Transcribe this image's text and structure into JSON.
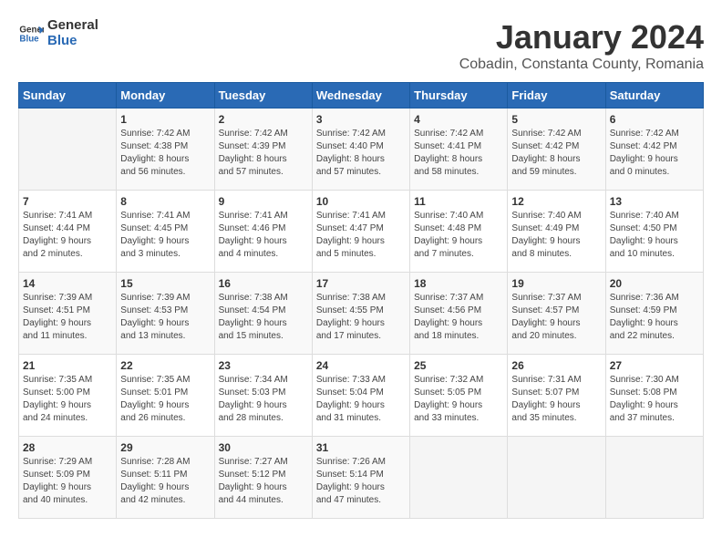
{
  "logo": {
    "line1": "General",
    "line2": "Blue"
  },
  "header": {
    "title": "January 2024",
    "subtitle": "Cobadin, Constanta County, Romania"
  },
  "days_of_week": [
    "Sunday",
    "Monday",
    "Tuesday",
    "Wednesday",
    "Thursday",
    "Friday",
    "Saturday"
  ],
  "weeks": [
    [
      {
        "day": "",
        "info": ""
      },
      {
        "day": "1",
        "info": "Sunrise: 7:42 AM\nSunset: 4:38 PM\nDaylight: 8 hours\nand 56 minutes."
      },
      {
        "day": "2",
        "info": "Sunrise: 7:42 AM\nSunset: 4:39 PM\nDaylight: 8 hours\nand 57 minutes."
      },
      {
        "day": "3",
        "info": "Sunrise: 7:42 AM\nSunset: 4:40 PM\nDaylight: 8 hours\nand 57 minutes."
      },
      {
        "day": "4",
        "info": "Sunrise: 7:42 AM\nSunset: 4:41 PM\nDaylight: 8 hours\nand 58 minutes."
      },
      {
        "day": "5",
        "info": "Sunrise: 7:42 AM\nSunset: 4:42 PM\nDaylight: 8 hours\nand 59 minutes."
      },
      {
        "day": "6",
        "info": "Sunrise: 7:42 AM\nSunset: 4:42 PM\nDaylight: 9 hours\nand 0 minutes."
      }
    ],
    [
      {
        "day": "7",
        "info": "Sunrise: 7:41 AM\nSunset: 4:44 PM\nDaylight: 9 hours\nand 2 minutes."
      },
      {
        "day": "8",
        "info": "Sunrise: 7:41 AM\nSunset: 4:45 PM\nDaylight: 9 hours\nand 3 minutes."
      },
      {
        "day": "9",
        "info": "Sunrise: 7:41 AM\nSunset: 4:46 PM\nDaylight: 9 hours\nand 4 minutes."
      },
      {
        "day": "10",
        "info": "Sunrise: 7:41 AM\nSunset: 4:47 PM\nDaylight: 9 hours\nand 5 minutes."
      },
      {
        "day": "11",
        "info": "Sunrise: 7:40 AM\nSunset: 4:48 PM\nDaylight: 9 hours\nand 7 minutes."
      },
      {
        "day": "12",
        "info": "Sunrise: 7:40 AM\nSunset: 4:49 PM\nDaylight: 9 hours\nand 8 minutes."
      },
      {
        "day": "13",
        "info": "Sunrise: 7:40 AM\nSunset: 4:50 PM\nDaylight: 9 hours\nand 10 minutes."
      }
    ],
    [
      {
        "day": "14",
        "info": "Sunrise: 7:39 AM\nSunset: 4:51 PM\nDaylight: 9 hours\nand 11 minutes."
      },
      {
        "day": "15",
        "info": "Sunrise: 7:39 AM\nSunset: 4:53 PM\nDaylight: 9 hours\nand 13 minutes."
      },
      {
        "day": "16",
        "info": "Sunrise: 7:38 AM\nSunset: 4:54 PM\nDaylight: 9 hours\nand 15 minutes."
      },
      {
        "day": "17",
        "info": "Sunrise: 7:38 AM\nSunset: 4:55 PM\nDaylight: 9 hours\nand 17 minutes."
      },
      {
        "day": "18",
        "info": "Sunrise: 7:37 AM\nSunset: 4:56 PM\nDaylight: 9 hours\nand 18 minutes."
      },
      {
        "day": "19",
        "info": "Sunrise: 7:37 AM\nSunset: 4:57 PM\nDaylight: 9 hours\nand 20 minutes."
      },
      {
        "day": "20",
        "info": "Sunrise: 7:36 AM\nSunset: 4:59 PM\nDaylight: 9 hours\nand 22 minutes."
      }
    ],
    [
      {
        "day": "21",
        "info": "Sunrise: 7:35 AM\nSunset: 5:00 PM\nDaylight: 9 hours\nand 24 minutes."
      },
      {
        "day": "22",
        "info": "Sunrise: 7:35 AM\nSunset: 5:01 PM\nDaylight: 9 hours\nand 26 minutes."
      },
      {
        "day": "23",
        "info": "Sunrise: 7:34 AM\nSunset: 5:03 PM\nDaylight: 9 hours\nand 28 minutes."
      },
      {
        "day": "24",
        "info": "Sunrise: 7:33 AM\nSunset: 5:04 PM\nDaylight: 9 hours\nand 31 minutes."
      },
      {
        "day": "25",
        "info": "Sunrise: 7:32 AM\nSunset: 5:05 PM\nDaylight: 9 hours\nand 33 minutes."
      },
      {
        "day": "26",
        "info": "Sunrise: 7:31 AM\nSunset: 5:07 PM\nDaylight: 9 hours\nand 35 minutes."
      },
      {
        "day": "27",
        "info": "Sunrise: 7:30 AM\nSunset: 5:08 PM\nDaylight: 9 hours\nand 37 minutes."
      }
    ],
    [
      {
        "day": "28",
        "info": "Sunrise: 7:29 AM\nSunset: 5:09 PM\nDaylight: 9 hours\nand 40 minutes."
      },
      {
        "day": "29",
        "info": "Sunrise: 7:28 AM\nSunset: 5:11 PM\nDaylight: 9 hours\nand 42 minutes."
      },
      {
        "day": "30",
        "info": "Sunrise: 7:27 AM\nSunset: 5:12 PM\nDaylight: 9 hours\nand 44 minutes."
      },
      {
        "day": "31",
        "info": "Sunrise: 7:26 AM\nSunset: 5:14 PM\nDaylight: 9 hours\nand 47 minutes."
      },
      {
        "day": "",
        "info": ""
      },
      {
        "day": "",
        "info": ""
      },
      {
        "day": "",
        "info": ""
      }
    ]
  ]
}
